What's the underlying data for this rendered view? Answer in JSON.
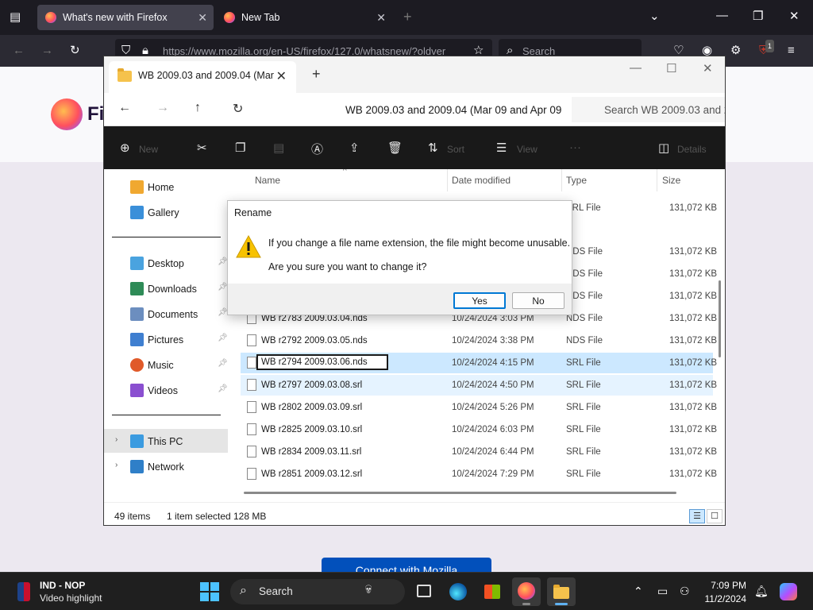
{
  "browser": {
    "tabs": [
      {
        "label": "What's new with Firefox",
        "active": true
      },
      {
        "label": "New Tab",
        "active": false
      }
    ],
    "url": "https://www.mozilla.org/en-US/firefox/127.0/whatsnew/?oldver",
    "search_placeholder": "Search",
    "extension_badge": "1",
    "page_logo_text": "Fi",
    "page_button": "Connect with Mozilla"
  },
  "explorer": {
    "tab_title": "WB 2009.03 and 2009.04 (Mar",
    "address_text": "WB 2009.03 and 2009.04 (Mar 09 and Apr 09",
    "search_placeholder": "Search WB 2009.03 and 2",
    "commands": {
      "new": "New",
      "sort": "Sort",
      "view": "View",
      "details": "Details"
    },
    "sidebar": {
      "home": "Home",
      "gallery": "Gallery",
      "desktop": "Desktop",
      "downloads": "Downloads",
      "documents": "Documents",
      "pictures": "Pictures",
      "music": "Music",
      "videos": "Videos",
      "this_pc": "This PC",
      "network": "Network"
    },
    "columns": {
      "name": "Name",
      "date": "Date modified",
      "type": "Type",
      "size": "Size"
    },
    "rows": [
      {
        "name": "",
        "date": "",
        "type": "SRL File",
        "size": "131,072 KB"
      },
      {
        "name": "",
        "date": "",
        "type": "NDS File",
        "size": "131,072 KB"
      },
      {
        "name": "",
        "date": "",
        "type": "NDS File",
        "size": "131,072 KB"
      },
      {
        "name": "",
        "date": "",
        "type": "NDS File",
        "size": "131,072 KB"
      },
      {
        "name": "WB r2783 2009.03.04.nds",
        "date": "10/24/2024 3:03 PM",
        "type": "NDS File",
        "size": "131,072 KB"
      },
      {
        "name": "WB r2792 2009.03.05.nds",
        "date": "10/24/2024 3:38 PM",
        "type": "NDS File",
        "size": "131,072 KB"
      },
      {
        "name": "WB r2794 2009.03.06.nds",
        "date": "10/24/2024 4:15 PM",
        "type": "SRL File",
        "size": "131,072 KB"
      },
      {
        "name": "WB r2797 2009.03.08.srl",
        "date": "10/24/2024 4:50 PM",
        "type": "SRL File",
        "size": "131,072 KB"
      },
      {
        "name": "WB r2802 2009.03.09.srl",
        "date": "10/24/2024 5:26 PM",
        "type": "SRL File",
        "size": "131,072 KB"
      },
      {
        "name": "WB r2825 2009.03.10.srl",
        "date": "10/24/2024 6:03 PM",
        "type": "SRL File",
        "size": "131,072 KB"
      },
      {
        "name": "WB r2834 2009.03.11.srl",
        "date": "10/24/2024 6:44 PM",
        "type": "SRL File",
        "size": "131,072 KB"
      },
      {
        "name": "WB r2851 2009.03.12.srl",
        "date": "10/24/2024 7:29 PM",
        "type": "SRL File",
        "size": "131,072 KB"
      }
    ],
    "status": {
      "items": "49 items",
      "selected": "1 item selected",
      "size": "128 MB"
    }
  },
  "dialog": {
    "title": "Rename",
    "message1": "If you change a file name extension, the file might become unusable.",
    "message2": "Are you sure you want to change it?",
    "yes": "Yes",
    "no": "No"
  },
  "taskbar": {
    "news_title": "IND - NOP",
    "news_subtitle": "Video highlight",
    "search": "Search",
    "time": "7:09 PM",
    "date": "11/2/2024"
  },
  "colors": {
    "accent": "#0078d4",
    "selection": "#cce8ff",
    "folder": "#f5c24c"
  }
}
